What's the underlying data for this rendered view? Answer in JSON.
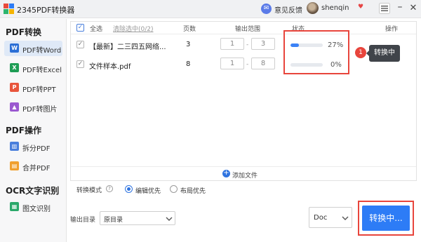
{
  "titlebar": {
    "app_title": "2345PDF转换器",
    "feedback_label": "意见反馈",
    "username": "shenqin"
  },
  "sidebar": {
    "sections": [
      {
        "title": "PDF转换",
        "items": [
          {
            "label": "PDF转Word",
            "icon": "word-icon",
            "color": "#2b6fd6"
          },
          {
            "label": "PDF转Excel",
            "icon": "excel-icon",
            "color": "#1f9d55"
          },
          {
            "label": "PDF转PPT",
            "icon": "ppt-icon",
            "color": "#e8553c"
          },
          {
            "label": "PDF转图片",
            "icon": "image-icon",
            "color": "#9b59d0"
          }
        ]
      },
      {
        "title": "PDF操作",
        "items": [
          {
            "label": "拆分PDF",
            "icon": "split-icon",
            "color": "#4a7fdc"
          },
          {
            "label": "合并PDF",
            "icon": "merge-icon",
            "color": "#f0a030"
          }
        ]
      },
      {
        "title": "OCR文字识别",
        "items": [
          {
            "label": "图文识别",
            "icon": "ocr-icon",
            "color": "#2aa86a"
          }
        ]
      }
    ]
  },
  "table": {
    "select_all": "全选",
    "clear_selected": "清除选中(0/2)",
    "headers": {
      "pages": "页数",
      "range": "输出范围",
      "status": "状态",
      "action": "操作"
    },
    "rows": [
      {
        "name": "【最新】二三四五网络...",
        "pages": "3",
        "range_from": "1",
        "range_to": "3",
        "progress": 27,
        "progress_label": "27%"
      },
      {
        "name": "文件样本.pdf",
        "pages": "8",
        "range_from": "1",
        "range_to": "8",
        "progress": 0,
        "progress_label": "0%"
      }
    ],
    "add_file": "添加文件"
  },
  "annotation": {
    "badge": "1",
    "tooltip": "转换中"
  },
  "mode": {
    "label": "转换模式",
    "options": [
      {
        "label": "编辑优先",
        "selected": true
      },
      {
        "label": "布局优先",
        "selected": false
      }
    ]
  },
  "output": {
    "label": "输出目录",
    "value": "原目录"
  },
  "format": {
    "value": "Doc"
  },
  "convert_button": "转换中...",
  "colors": {
    "accent": "#2d7cf6",
    "highlight": "#e8453c",
    "progress_fill": "#3b82f6"
  }
}
